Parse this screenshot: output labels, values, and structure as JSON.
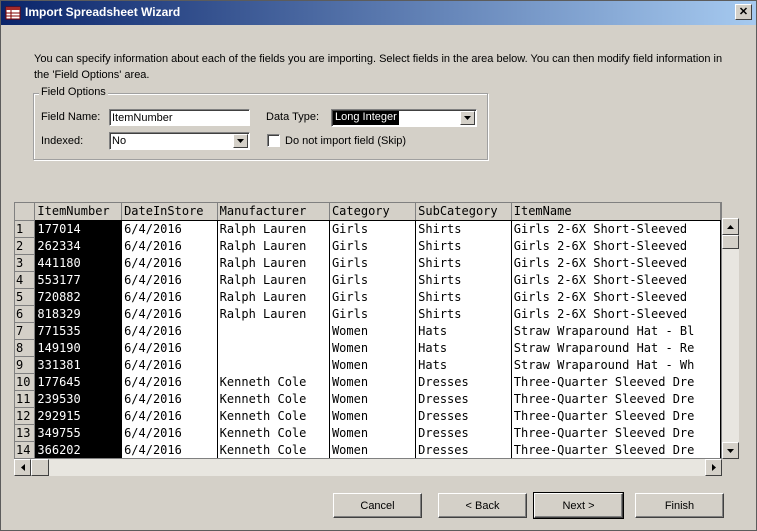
{
  "window": {
    "title": "Import Spreadsheet Wizard",
    "close_glyph": "✕"
  },
  "intro_text": "You can specify information about each of the fields you are importing. Select fields in the area below. You can then modify field information in the 'Field Options' area.",
  "field_options": {
    "legend": "Field Options",
    "field_name_label": "Field Name:",
    "field_name_value": "ItemNumber",
    "data_type_label": "Data Type:",
    "data_type_value": "Long Integer",
    "indexed_label": "Indexed:",
    "indexed_value": "No",
    "skip_label": "Do not import field (Skip)",
    "skip_checked": false
  },
  "grid": {
    "columns": [
      "ItemNumber",
      "DateInStore",
      "Manufacturer",
      "Category",
      "SubCategory",
      "ItemName"
    ],
    "rows": [
      [
        "1",
        "177014",
        "6/4/2016",
        "Ralph Lauren",
        "Girls",
        "Shirts",
        "Girls 2-6X Short-Sleeved"
      ],
      [
        "2",
        "262334",
        "6/4/2016",
        "Ralph Lauren",
        "Girls",
        "Shirts",
        "Girls 2-6X Short-Sleeved"
      ],
      [
        "3",
        "441180",
        "6/4/2016",
        "Ralph Lauren",
        "Girls",
        "Shirts",
        "Girls 2-6X Short-Sleeved"
      ],
      [
        "4",
        "553177",
        "6/4/2016",
        "Ralph Lauren",
        "Girls",
        "Shirts",
        "Girls 2-6X Short-Sleeved"
      ],
      [
        "5",
        "720882",
        "6/4/2016",
        "Ralph Lauren",
        "Girls",
        "Shirts",
        "Girls 2-6X Short-Sleeved"
      ],
      [
        "6",
        "818329",
        "6/4/2016",
        "Ralph Lauren",
        "Girls",
        "Shirts",
        "Girls 2-6X Short-Sleeved"
      ],
      [
        "7",
        "771535",
        "6/4/2016",
        "",
        "Women",
        "Hats",
        "Straw Wraparound Hat - Bl"
      ],
      [
        "8",
        "149190",
        "6/4/2016",
        "",
        "Women",
        "Hats",
        "Straw Wraparound Hat - Re"
      ],
      [
        "9",
        "331381",
        "6/4/2016",
        "",
        "Women",
        "Hats",
        "Straw Wraparound Hat - Wh"
      ],
      [
        "10",
        "177645",
        "6/4/2016",
        "Kenneth Cole",
        "Women",
        "Dresses",
        "Three-Quarter Sleeved Dre"
      ],
      [
        "11",
        "239530",
        "6/4/2016",
        "Kenneth Cole",
        "Women",
        "Dresses",
        "Three-Quarter Sleeved Dre"
      ],
      [
        "12",
        "292915",
        "6/4/2016",
        "Kenneth Cole",
        "Women",
        "Dresses",
        "Three-Quarter Sleeved Dre"
      ],
      [
        "13",
        "349755",
        "6/4/2016",
        "Kenneth Cole",
        "Women",
        "Dresses",
        "Three-Quarter Sleeved Dre"
      ],
      [
        "14",
        "366202",
        "6/4/2016",
        "Kenneth Cole",
        "Women",
        "Dresses",
        "Three-Quarter Sleeved Dre"
      ]
    ]
  },
  "buttons": {
    "cancel": "Cancel",
    "back": "< Back",
    "next": "Next >",
    "finish": "Finish"
  },
  "icons": {
    "app": "access-table-icon",
    "close": "close-icon",
    "dropdown": "chevron-down-icon",
    "scroll_up": "arrow-up-icon",
    "scroll_down": "arrow-down-icon",
    "scroll_left": "arrow-left-icon",
    "scroll_right": "arrow-right-icon"
  }
}
